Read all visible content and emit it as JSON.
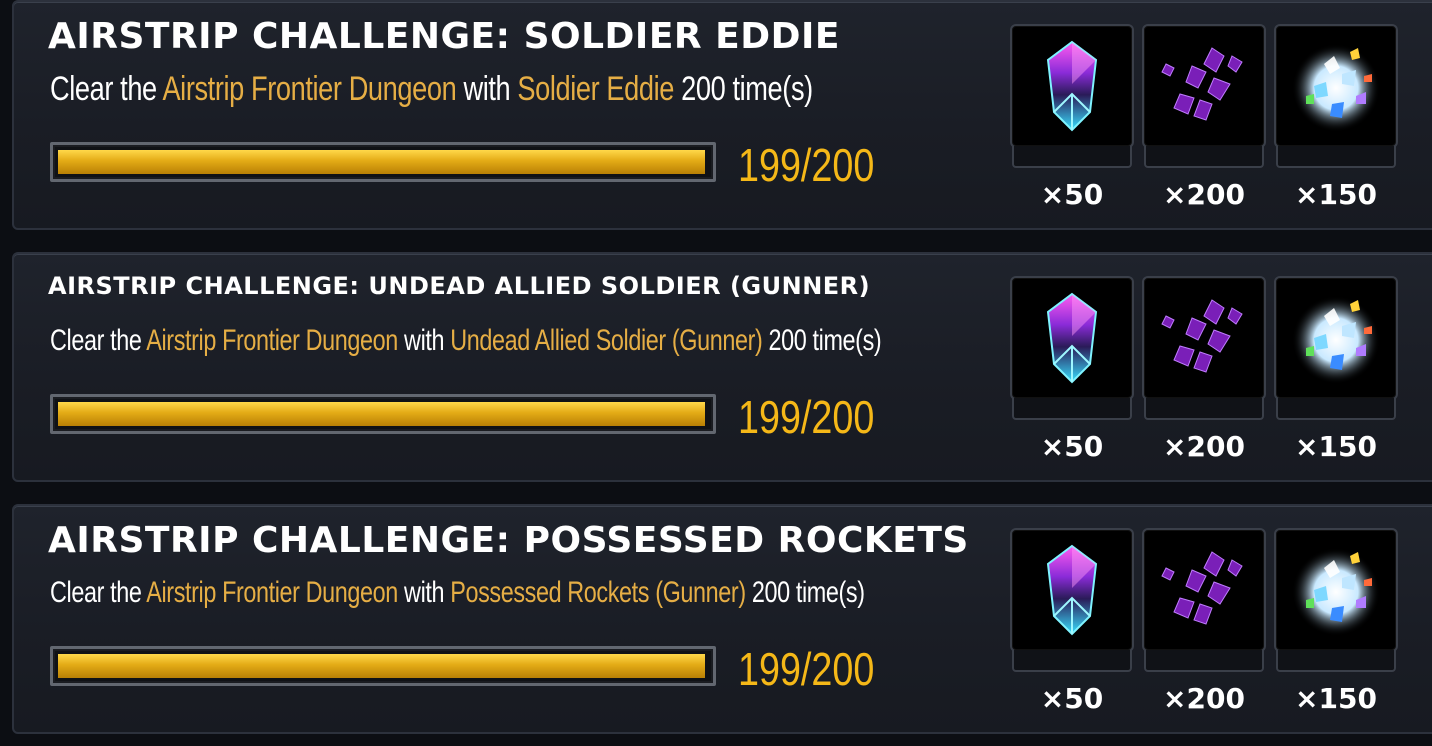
{
  "challenges": [
    {
      "title": "AIRSTRIP CHALLENGE: SOLDIER EDDIE",
      "desc_prefix": "Clear the",
      "dungeon": "Airstrip Frontier Dungeon",
      "desc_with": "with",
      "character": "Soldier Eddie",
      "desc_suffix": "200 time(s)",
      "progress_text": "199/200",
      "progress_fraction": 0.995,
      "rewards": [
        {
          "icon": "crystal-icon",
          "qty": "×50"
        },
        {
          "icon": "shards-icon",
          "qty": "×200"
        },
        {
          "icon": "gem-cluster-icon",
          "qty": "×150"
        }
      ]
    },
    {
      "title": "AIRSTRIP CHALLENGE: UNDEAD ALLIED SOLDIER (GUNNER)",
      "desc_prefix": "Clear the",
      "dungeon": "Airstrip Frontier Dungeon",
      "desc_with": "with",
      "character": "Undead Allied Soldier (Gunner)",
      "desc_suffix": "200 time(s)",
      "progress_text": "199/200",
      "progress_fraction": 0.995,
      "rewards": [
        {
          "icon": "crystal-icon",
          "qty": "×50"
        },
        {
          "icon": "shards-icon",
          "qty": "×200"
        },
        {
          "icon": "gem-cluster-icon",
          "qty": "×150"
        }
      ]
    },
    {
      "title": "AIRSTRIP CHALLENGE: POSSESSED ROCKETS",
      "desc_prefix": "Clear the",
      "dungeon": "Airstrip Frontier Dungeon",
      "desc_with": "with",
      "character": "Possessed Rockets (Gunner)",
      "desc_suffix": "200 time(s)",
      "progress_text": "199/200",
      "progress_fraction": 0.995,
      "rewards": [
        {
          "icon": "crystal-icon",
          "qty": "×50"
        },
        {
          "icon": "shards-icon",
          "qty": "×200"
        },
        {
          "icon": "gem-cluster-icon",
          "qty": "×150"
        }
      ]
    }
  ],
  "colors": {
    "highlight": "#e6ae45",
    "progress_text": "#f5b818",
    "bar_fill": "#e3ab16"
  }
}
